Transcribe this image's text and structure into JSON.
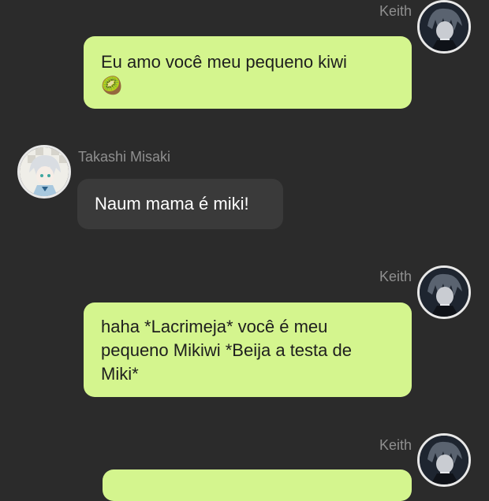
{
  "messages": [
    {
      "sender": "Keith",
      "direction": "outgoing",
      "lines": [
        "Eu amo você meu pequeno kiwi",
        "🥝"
      ]
    },
    {
      "sender": "Takashi Misaki",
      "direction": "incoming",
      "lines": [
        "Naum mama é miki!"
      ]
    },
    {
      "sender": "Keith",
      "direction": "outgoing",
      "lines": [
        "haha *Lacrimeja* você é meu",
        "pequeno Mikiwi *Beija a testa de",
        "Miki*"
      ]
    },
    {
      "sender": "Keith",
      "direction": "outgoing",
      "lines": []
    }
  ],
  "colors": {
    "background": "#2b2b2b",
    "outgoing_bubble": "#d4f58e",
    "incoming_bubble": "#3a3a3a",
    "sender_name": "#8f8f8f"
  }
}
